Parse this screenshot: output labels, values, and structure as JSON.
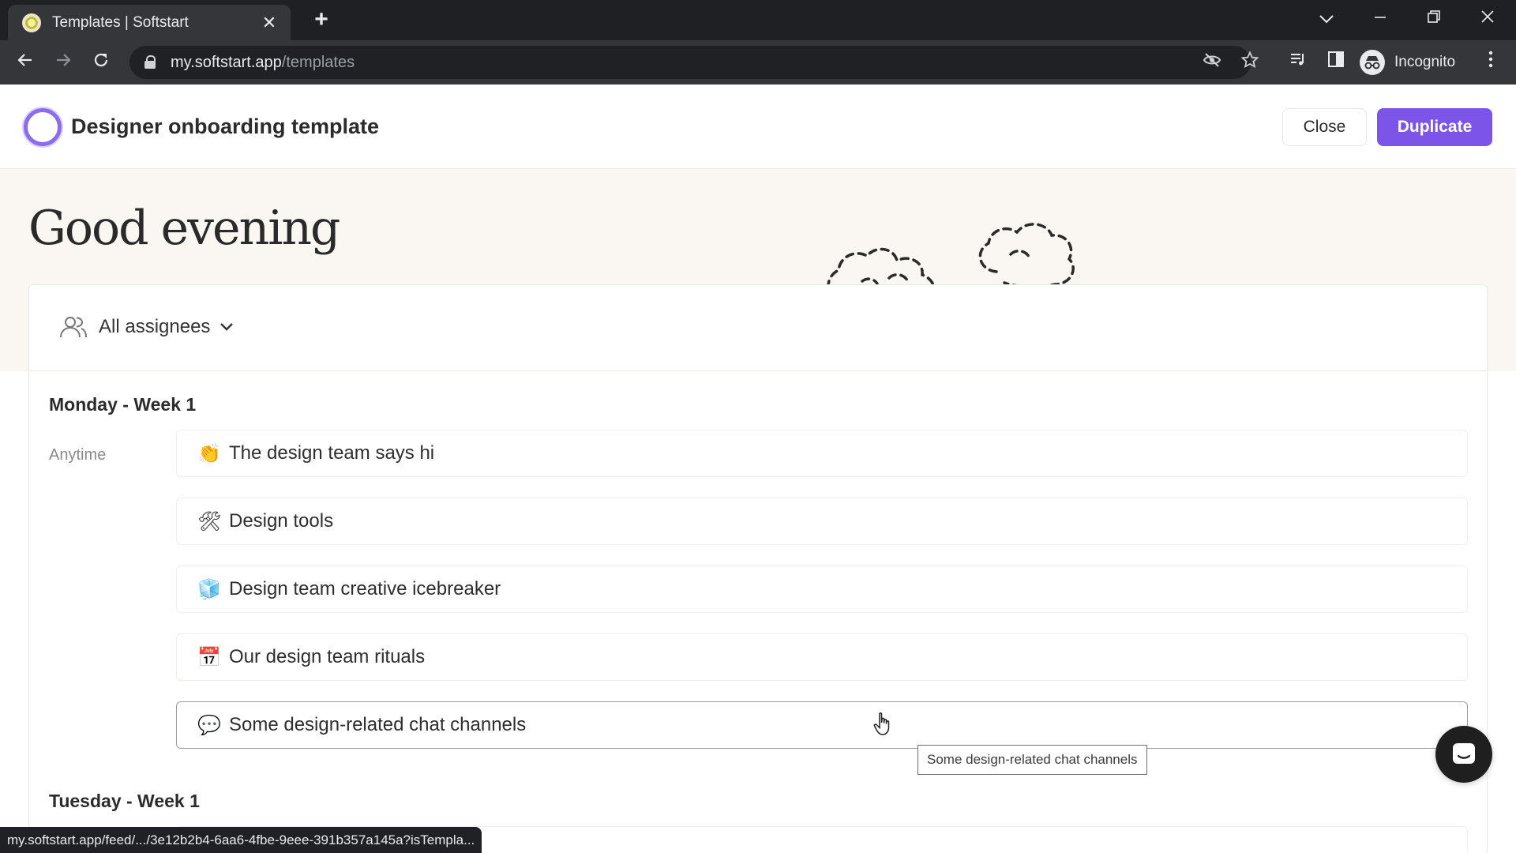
{
  "browser": {
    "tab_title": "Templates | Softstart",
    "tab_close_glyph": "✕",
    "newtab_glyph": "+",
    "url_host": "my.softstart.app",
    "url_path": "/templates",
    "profile_label": "Incognito",
    "status_url": "my.softstart.app/feed/.../3e12b2b4-6aa6-4fbe-9eee-391b357a145a?isTempla..."
  },
  "header": {
    "title": "Designer onboarding template",
    "close_label": "Close",
    "duplicate_label": "Duplicate"
  },
  "hero": {
    "greeting": "Good evening"
  },
  "filter": {
    "label": "All assignees"
  },
  "days": [
    {
      "title": "Monday - Week 1",
      "slot": "Anytime",
      "tasks": [
        {
          "emoji": "👏",
          "icon": "clapping-hands-icon",
          "title": "The design team says hi"
        },
        {
          "emoji": "🛠",
          "icon": "tools-icon",
          "title": "Design tools"
        },
        {
          "emoji": "🧊",
          "icon": "ice-cube-icon",
          "title": "Design team creative icebreaker"
        },
        {
          "emoji": "📅",
          "icon": "calendar-icon",
          "title": "Our design team rituals"
        },
        {
          "emoji": "💬",
          "icon": "speech-bubble-icon",
          "title": "Some design-related chat channels"
        }
      ]
    },
    {
      "title": "Tuesday - Week 1"
    }
  ],
  "tooltip": {
    "text": "Some design-related chat channels"
  },
  "colors": {
    "accent": "#7c55e8",
    "hero_bg": "#faf7f3",
    "chrome_dark": "#35363a"
  }
}
